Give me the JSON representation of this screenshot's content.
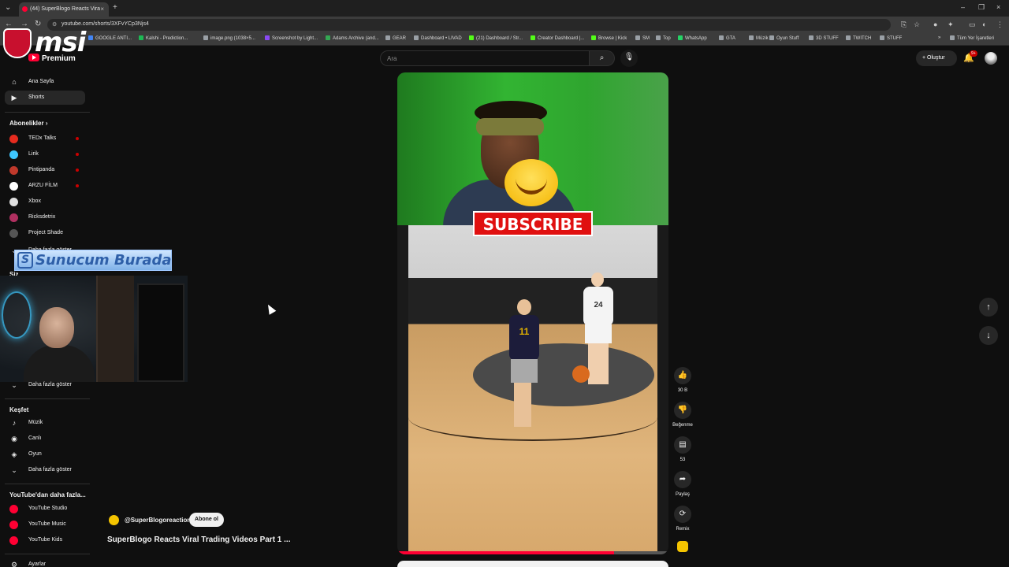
{
  "browser": {
    "tab_title": "(44) SuperBlogo Reacts Vira",
    "url": "youtube.com/shorts/3XFvYCp3Njs4",
    "bookmarks": [
      {
        "label": "GOOGLE ANTI...",
        "color": "#4285f4"
      },
      {
        "label": "Kalshi - Prediction...",
        "color": "#1db954"
      },
      {
        "label": "image.png (1038×5...",
        "color": "#9aa0a6"
      },
      {
        "label": "Screenshot by Light...",
        "color": "#8a4af3"
      },
      {
        "label": "Adams Archive (and...",
        "color": "#34a853"
      },
      {
        "label": "GEAR",
        "color": "#9aa0a6"
      },
      {
        "label": "Dashboard • LIVAD",
        "color": "#9aa0a6"
      },
      {
        "label": "(21) Dashboard / Str...",
        "color": "#53fc18"
      },
      {
        "label": "Creator Dashboard |...",
        "color": "#53fc18"
      },
      {
        "label": "Browse | Kick",
        "color": "#53fc18"
      },
      {
        "label": "SM",
        "color": "#9aa0a6"
      },
      {
        "label": "Top",
        "color": "#9aa0a6"
      },
      {
        "label": "WhatsApp",
        "color": "#25d366"
      },
      {
        "label": "GTA",
        "color": "#9aa0a6"
      },
      {
        "label": "Müzik",
        "color": "#9aa0a6"
      },
      {
        "label": "Oyun Stuff",
        "color": "#9aa0a6"
      },
      {
        "label": "3D STUFF",
        "color": "#9aa0a6"
      },
      {
        "label": "TWITCH",
        "color": "#9aa0a6"
      },
      {
        "label": "STUFF",
        "color": "#9aa0a6"
      }
    ],
    "all_bookmarks": "Tüm Yer İşaretleri"
  },
  "overlay": {
    "logo_text": "msi",
    "banner_text": "Sunucum Burada",
    "banner_letter": "S"
  },
  "header": {
    "logo_text": "Premium",
    "search_placeholder": "Ara",
    "create_label": "Oluştur",
    "notif_count": "9+"
  },
  "sidebar": {
    "main": [
      {
        "label": "Ana Sayfa",
        "icon": "home-icon",
        "glyph": "⌂"
      },
      {
        "label": "Shorts",
        "icon": "shorts-icon",
        "glyph": "▶",
        "active": true
      }
    ],
    "subscriptions_heading": "Abonelikler",
    "subscriptions": [
      {
        "label": "TEDx Talks",
        "color": "#e62b1e",
        "live": true
      },
      {
        "label": "Lirik",
        "color": "#3ec7ff",
        "live": true
      },
      {
        "label": "Pintipanda",
        "color": "#c0392b",
        "live": true
      },
      {
        "label": "ARZU FİLM",
        "color": "#ffffff",
        "live": true
      },
      {
        "label": "Xbox",
        "color": "#e0e0e0",
        "live": false
      },
      {
        "label": "Ricksdetrix",
        "color": "#b03060",
        "live": false
      },
      {
        "label": "Project Shade",
        "color": "#555555",
        "live": false
      }
    ],
    "show_more_subs": "Daha fazla göster",
    "you_heading": "Siz",
    "show_more_1": "Daha fazla göster",
    "explore_heading": "Keşfet",
    "explore": [
      {
        "label": "Müzik",
        "icon": "music-icon",
        "glyph": "♪"
      },
      {
        "label": "Canlı",
        "icon": "live-icon",
        "glyph": "◉"
      },
      {
        "label": "Oyun",
        "icon": "gaming-icon",
        "glyph": "◈"
      }
    ],
    "show_more_2": "Daha fazla göster",
    "more_from_yt": "YouTube'dan daha fazla...",
    "yt_apps": [
      {
        "label": "YouTube Studio"
      },
      {
        "label": "YouTube Music"
      },
      {
        "label": "YouTube Kids"
      }
    ],
    "settings": "Ayarlar"
  },
  "video": {
    "overlay_text": "SUBSCRIBE",
    "jersey_1": "11",
    "jersey_2": "24",
    "progress_fraction": 0.8
  },
  "channel": {
    "handle": "@SuperBlogoreaction",
    "subscribe": "Abone ol",
    "title": "SuperBlogo Reacts Viral Trading Videos Part 1 ..."
  },
  "actions": {
    "likes": "30 B",
    "dislike": "Beğenme",
    "comments": "53",
    "share": "Paylaş",
    "remix": "Remix"
  }
}
